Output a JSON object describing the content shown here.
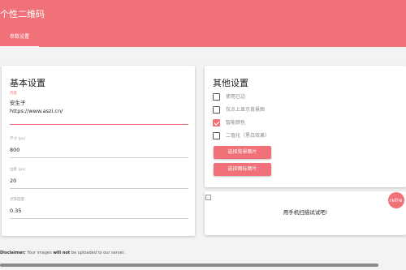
{
  "app": {
    "title": "个性二维码"
  },
  "tabs": [
    {
      "label": "参数设置",
      "active": true
    }
  ],
  "basic": {
    "title": "基本设置",
    "content_label": "内容",
    "content_line1": "安生子",
    "content_line2": "https://www.aszi.cn/",
    "size_label": "尺寸 (px)",
    "size_value": "800",
    "margin_label": "边距 (px)",
    "margin_value": "20",
    "point_label": "点阵密度",
    "point_value": "0.35"
  },
  "other": {
    "title": "其他设置",
    "options": [
      {
        "label": "使用已边",
        "checked": false
      },
      {
        "label": "仅点上显示背景图",
        "checked": false
      },
      {
        "label": "智能颜色",
        "checked": true
      },
      {
        "label": "二值化（黑白效果）",
        "checked": false
      }
    ],
    "bg_button": "选择背景图片",
    "icon_button": "选择图标图片"
  },
  "qr": {
    "refresh_label": "refre",
    "caption": "用手机扫描试试吧!"
  },
  "footer": {
    "prefix": "Disclaimer:",
    "middle": " Your images ",
    "strong": "will not",
    "suffix": " be uploaded to our server."
  },
  "colors": {
    "accent": "#f07177",
    "background": "#f3f3f3"
  }
}
